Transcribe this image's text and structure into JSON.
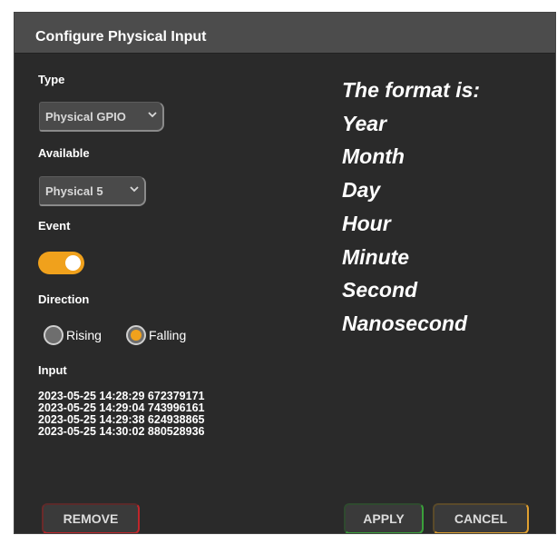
{
  "dialog": {
    "title": "Configure Physical Input",
    "type_label": "Type",
    "type_value": "Physical GPIO",
    "available_label": "Available",
    "available_value": "Physical 5",
    "event_label": "Event",
    "event_enabled": true,
    "direction_label": "Direction",
    "direction_options": [
      "Rising",
      "Falling"
    ],
    "direction_selected": "Falling",
    "input_label": "Input",
    "input_lines": [
      "2023-05-25 14:28:29 672379171",
      "2023-05-25 14:29:04 743996161",
      "2023-05-25 14:29:38 624938865",
      "2023-05-25 14:30:02 880528936"
    ],
    "buttons": {
      "remove": "REMOVE",
      "apply": "APPLY",
      "cancel": "CANCEL"
    }
  },
  "note": {
    "lines": [
      "The format is:",
      "Year",
      "Month",
      "Day",
      "Hour",
      "Minute",
      "Second",
      "Nanosecond"
    ]
  },
  "colors": {
    "accent": "#f0a11c",
    "remove_border": "#c0262a",
    "apply_border": "#3aa03a",
    "cancel_border": "#e0a030"
  },
  "icons": [
    "chevron-down-icon"
  ]
}
